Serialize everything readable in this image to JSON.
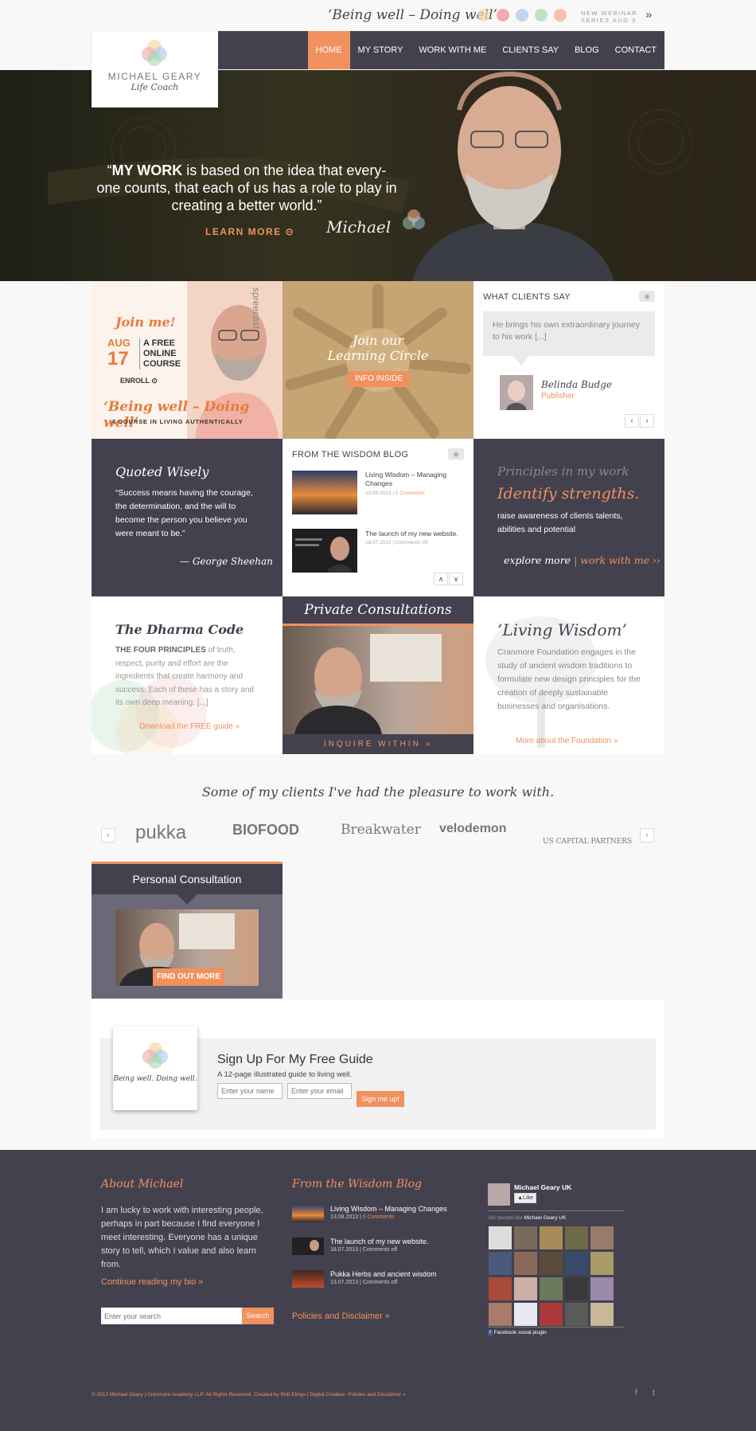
{
  "top": {
    "tagline": "‘Being well – Doing well’",
    "webinar_line1": "NEW WEBINAR",
    "webinar_line2": "SERIES AUG 3",
    "arrow": "»",
    "dot_colors": [
      "#f5d9a8",
      "#f08c8c",
      "#a8c8e8",
      "#a8d8b0",
      "#f5a888"
    ]
  },
  "nav": {
    "items": [
      "HOME",
      "MY STORY",
      "WORK WITH ME",
      "CLIENTS SAY",
      "BLOG",
      "CONTACT"
    ],
    "active": "HOME"
  },
  "logo": {
    "name": "MICHAEL GEARY",
    "sub": "Life Coach"
  },
  "hero": {
    "quote_bold": "MY WORK",
    "quote_open": "“",
    "quote_rest": " is based on the idea that every-one counts, that each of us has a role to play in creating a better world.”",
    "learn_more": "LEARN MORE",
    "signature": "Michael"
  },
  "tiles": {
    "course": {
      "join": "Join me!",
      "month": "AUG",
      "day": "17",
      "free": "A FREE",
      "online": "ONLINE",
      "course": "COURSE",
      "enroll": "ENROLL",
      "tag": "‘Being well – Doing well’",
      "sub": "A COURSE IN LIVING AUTHENTICALLY",
      "brand": "spreecast"
    },
    "circle": {
      "line1": "Join our",
      "line2": "Learning Circle",
      "button": "INFO INSIDE"
    },
    "clients_say": {
      "title": "WHAT CLIENTS SAY",
      "quote": "He brings his own extraordinary journey to his work [...]",
      "name": "Belinda Budge",
      "role": "Publisher"
    },
    "quoted": {
      "title": "Quoted Wisely",
      "text": "“Success means having the courage, the determination, and the will to become the person you believe you were meant to be.”",
      "author": "— George Sheehan"
    },
    "blog": {
      "title": "FROM THE WISDOM BLOG",
      "posts": [
        {
          "title": "Living Wisdom – Managing Changes",
          "date": "13.08.2013",
          "comments": "0 Comments"
        },
        {
          "title": "The launch of my new website.",
          "date": "18.07.2013",
          "comments": "Comments off"
        }
      ]
    },
    "principles": {
      "title": "Principles in my work",
      "headline": "Identify strengths.",
      "text": "raise awareness of clients talents, abilities and potential",
      "explore": "explore more",
      "sep": "|",
      "work": "work with me ››"
    },
    "dharma": {
      "title": "The Dharma Code",
      "lead": "THE FOUR PRINCIPLES",
      "text": " of truth, respect, purity and effort are the ingredients that create harmony and success. Each of these has a story and its own deep meaning. [...]",
      "link": "Download the FREE guide »"
    },
    "private": {
      "title": "Private Consultations",
      "button": "INQUIRE WITHIN  »"
    },
    "living": {
      "title": "‘Living Wisdom’",
      "text": "Cranmore Foundation engages in the study of ancient wisdom traditions to formulate new design principles for the creation of deeply sustainable businesses and organisations.",
      "link": "More about the Foundation »"
    },
    "personal": {
      "title": "Personal Consultation",
      "button": "FIND OUT MORE"
    }
  },
  "clients": {
    "title": "Some of my clients I've had the pleasure to work with.",
    "logos": [
      "pukka",
      "BIOFOOD",
      "Breakwater",
      "velodemon",
      "US CAPITAL PARTNERS"
    ]
  },
  "signup": {
    "title": "Sign Up For My Free Guide",
    "subtitle": "A 12-page illustrated guide to living well.",
    "name_placeholder": "Enter your name",
    "email_placeholder": "Enter your email",
    "button": "Sign me up!",
    "book_title": "Being well. Doing well."
  },
  "footer": {
    "about_title": "About Michael",
    "about_text": "I am lucky to work with interesting people, perhaps in part because I find everyone I meet interesting. Everyone has a unique story to tell, which I value and also learn from.",
    "about_link": "Continue reading my bio »",
    "search_placeholder": "Enter your search",
    "search_button": "Search",
    "blog_title": "From the Wisdom Blog",
    "posts": [
      {
        "title": "Living Wisdom – Managing Changes",
        "date": "13.08.2013",
        "comments": "0 Comments"
      },
      {
        "title": "The launch of my new website.",
        "date": "18.07.2013",
        "comments": "Comments off"
      },
      {
        "title": "Pukka Herbs and ancient wisdom",
        "date": "13.07.2013",
        "comments": "Comments off"
      }
    ],
    "policies": "Policies and Disclaimer »",
    "fb_name": "Michael Geary UK",
    "fb_like": "Like",
    "fb_count": "160 people like",
    "fb_count_name": "Michael Geary UK",
    "fb_plugin": "Facebook social plugin",
    "copyright": "© 2013 Michael Geary | Cranmore Academy LLP. All Rights Reserved. Created by Rob Elings | Digital Creative. Policies and Disclaimer »",
    "social_f": "f",
    "social_t": "t"
  }
}
